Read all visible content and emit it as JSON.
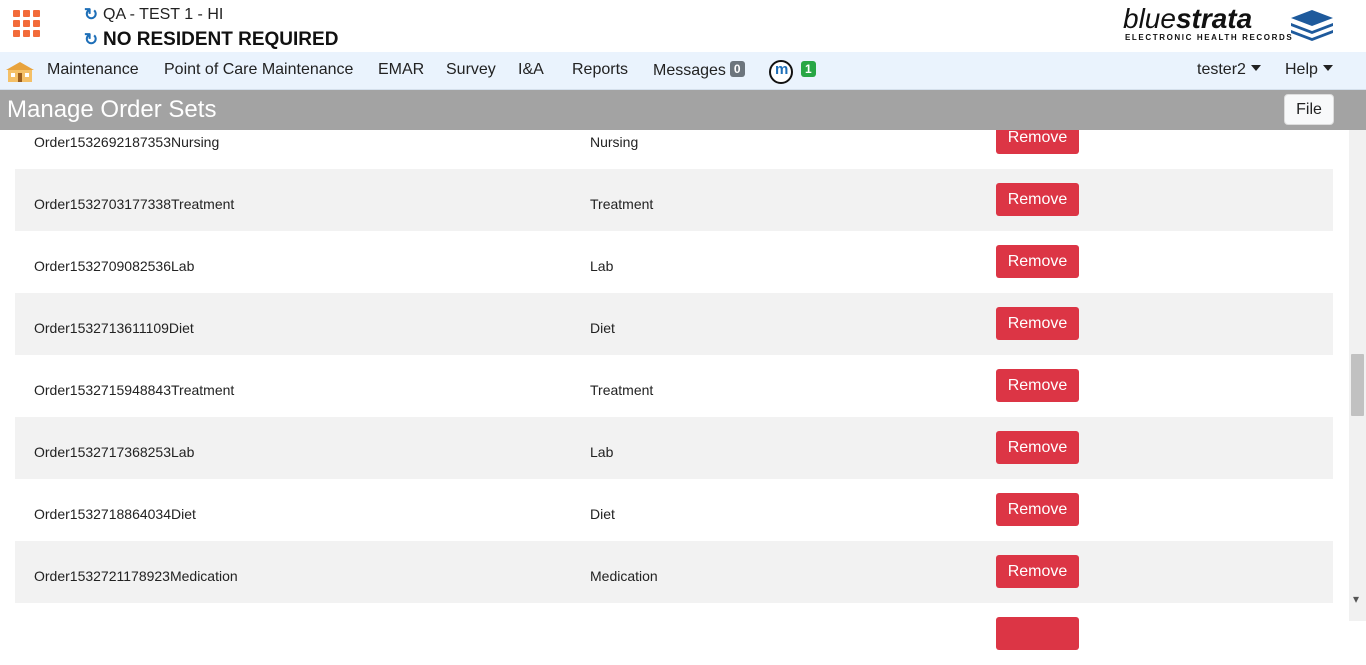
{
  "header": {
    "facility": "QA - TEST 1 - HI",
    "resident": "NO RESIDENT REQUIRED",
    "logo": {
      "word_light": "blue",
      "word_bold": "strata",
      "tagline": "ELECTRONIC HEALTH RECORDS"
    }
  },
  "nav": {
    "items": [
      "Maintenance",
      "Point of Care Maintenance",
      "EMAR",
      "Survey",
      "I&A",
      "Reports"
    ],
    "messages_label": "Messages",
    "messages_count": "0",
    "m_count": "1",
    "user": "tester2",
    "help": "Help"
  },
  "page": {
    "title": "Manage Order Sets",
    "file_label": "File"
  },
  "table": {
    "remove_label": "Remove",
    "rows": [
      {
        "name": "Order1532692187353Nursing",
        "type": "Nursing"
      },
      {
        "name": "Order1532703177338Treatment",
        "type": "Treatment"
      },
      {
        "name": "Order1532709082536Lab",
        "type": "Lab"
      },
      {
        "name": "Order1532713611109Diet",
        "type": "Diet"
      },
      {
        "name": "Order1532715948843Treatment",
        "type": "Treatment"
      },
      {
        "name": "Order1532717368253Lab",
        "type": "Lab"
      },
      {
        "name": "Order1532718864034Diet",
        "type": "Diet"
      },
      {
        "name": "Order1532721178923Medication",
        "type": "Medication"
      },
      {
        "name": "",
        "type": ""
      }
    ]
  },
  "colors": {
    "remove": "#dc3545",
    "titlebar": "#a3a3a3",
    "navbar": "#eaf3fd",
    "apps": "#f26b3a"
  }
}
